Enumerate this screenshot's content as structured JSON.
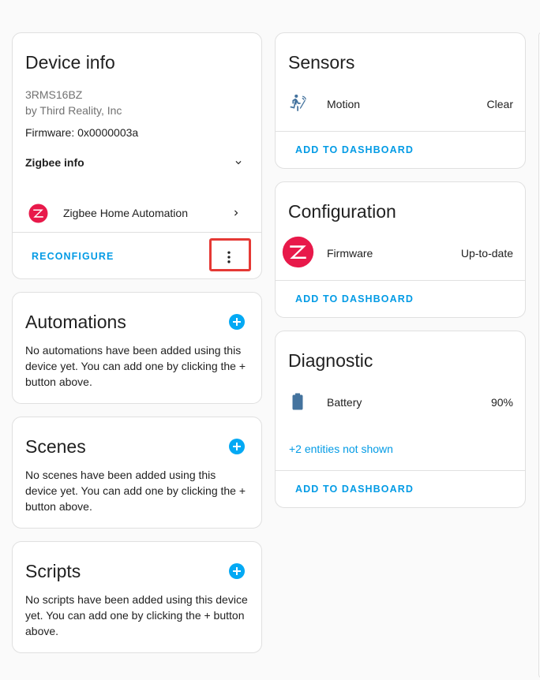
{
  "device_info": {
    "title": "Device info",
    "model": "3RMS16BZ",
    "manufacturer": "by Third Reality, Inc",
    "firmware": "Firmware: 0x0000003a",
    "zigbee_info_label": "Zigbee info",
    "integration_label": "Zigbee Home Automation",
    "reconfigure_label": "RECONFIGURE"
  },
  "automations": {
    "title": "Automations",
    "description": "No automations have been added using this device yet. You can add one by clicking the + button above."
  },
  "scenes": {
    "title": "Scenes",
    "description": "No scenes have been added using this device yet. You can add one by clicking the + button above."
  },
  "scripts": {
    "title": "Scripts",
    "description": "No scripts have been added using this device yet. You can add one by clicking the + button above."
  },
  "sensors": {
    "title": "Sensors",
    "entity_name": "Motion",
    "entity_state": "Clear",
    "entity_icon": "motion-sensor-icon",
    "add_label": "ADD TO DASHBOARD"
  },
  "configuration": {
    "title": "Configuration",
    "entity_name": "Firmware",
    "entity_state": "Up-to-date",
    "entity_icon": "zigbee-logo",
    "add_label": "ADD TO DASHBOARD"
  },
  "diagnostic": {
    "title": "Diagnostic",
    "entity_name": "Battery",
    "entity_state": "90%",
    "entity_icon": "battery-icon",
    "hidden_entities": "+2 entities not shown",
    "add_label": "ADD TO DASHBOARD"
  },
  "colors": {
    "accent": "#03a9f4",
    "link": "#039be5",
    "highlight": "#e53935",
    "zigbee_red": "#e8194a",
    "icon_gray": "#44739e"
  }
}
